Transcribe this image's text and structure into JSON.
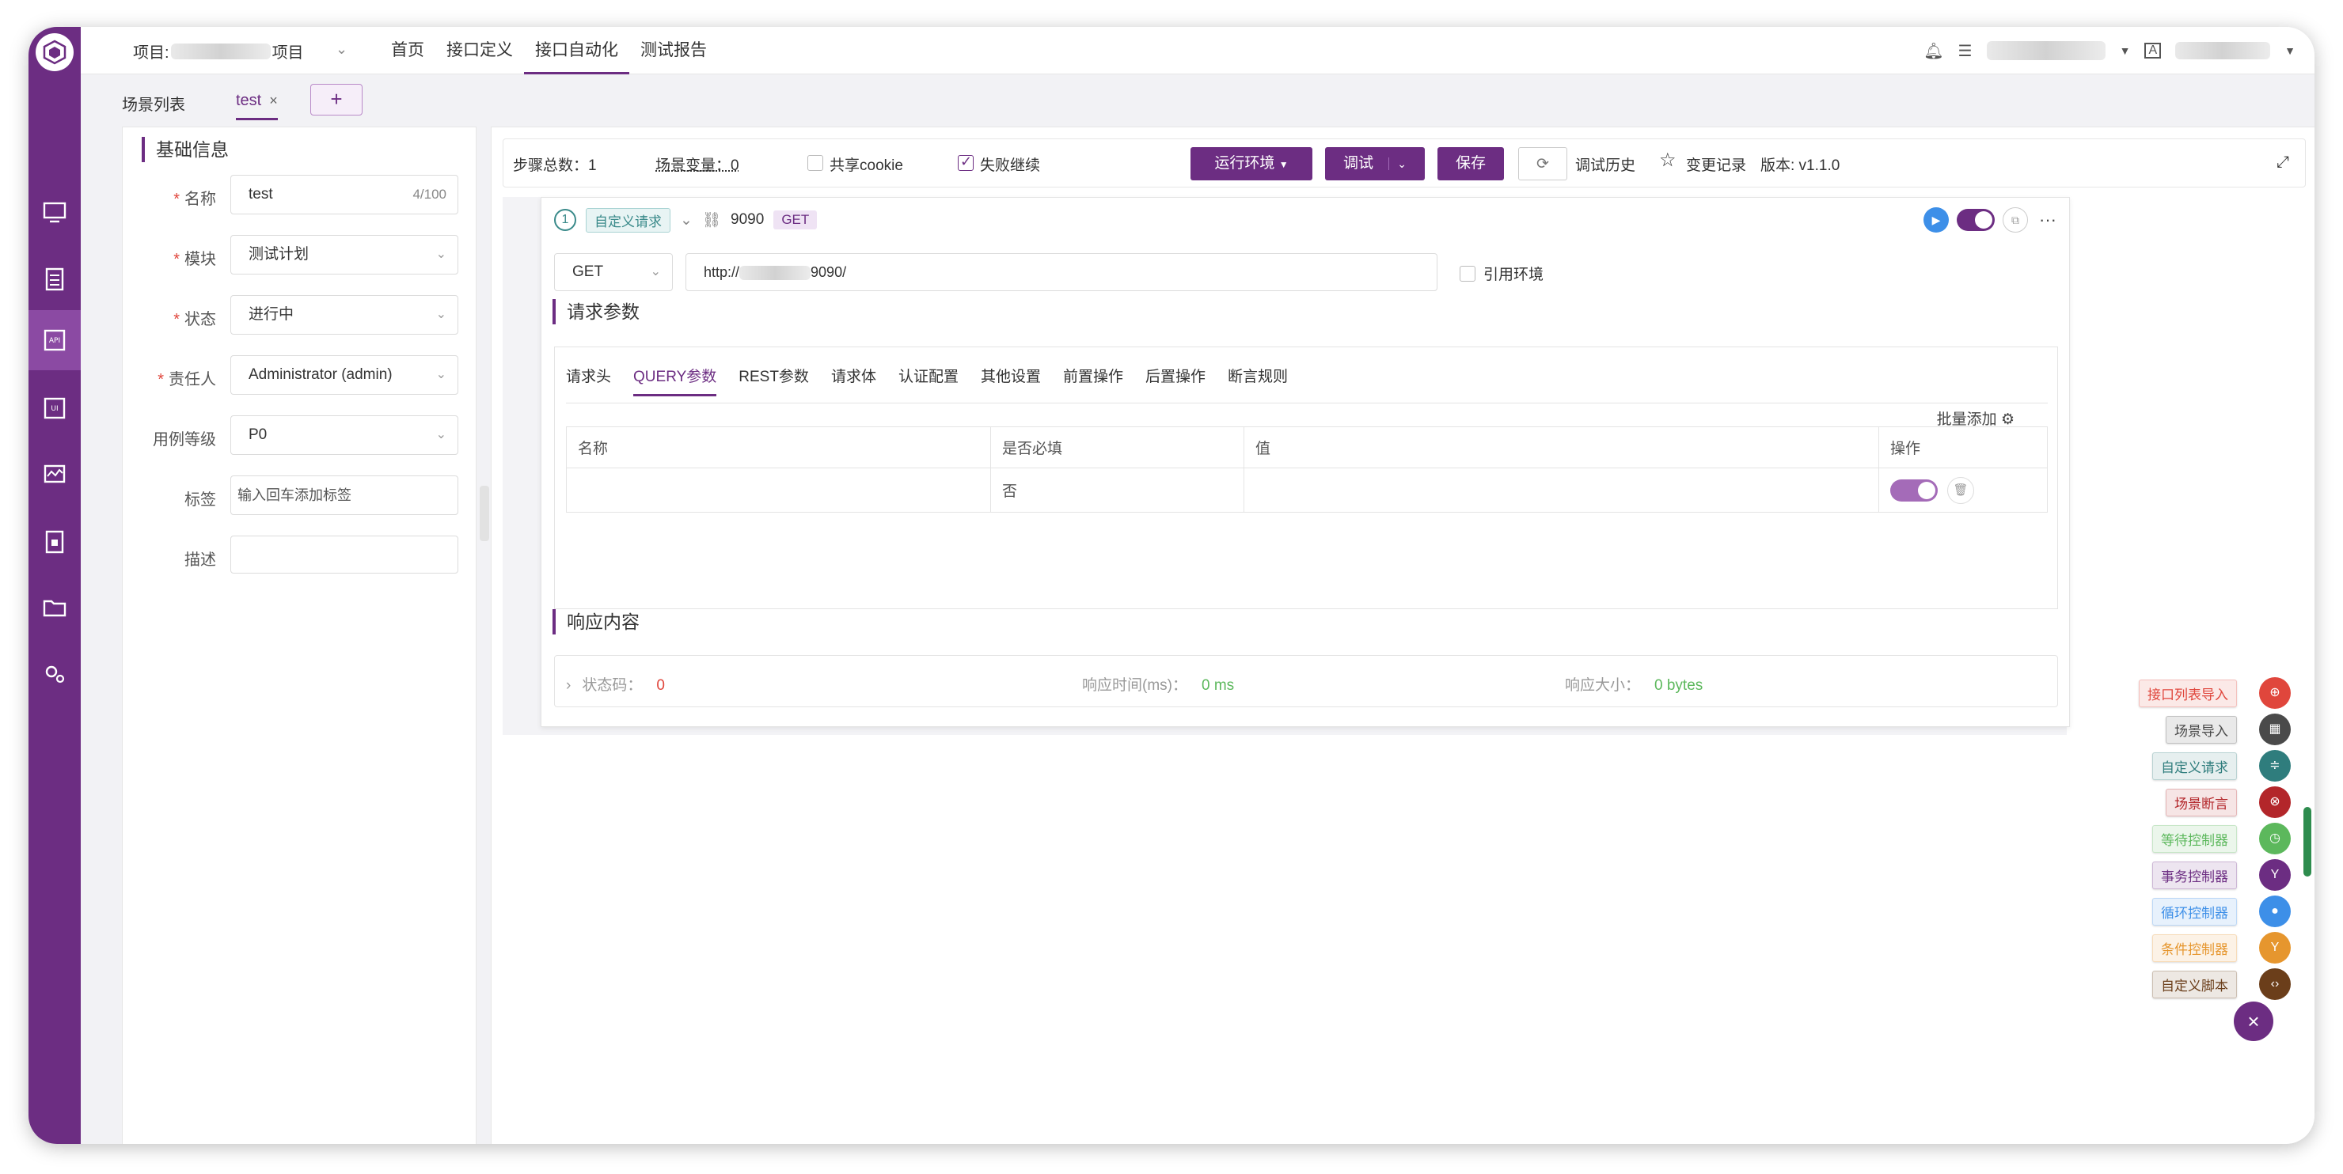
{
  "topbar": {
    "project_prefix": "项目:",
    "project_suffix": "项目",
    "nav": [
      "首页",
      "接口定义",
      "接口自动化",
      "测试报告"
    ],
    "active_nav": "接口自动化"
  },
  "tabs": {
    "list_label": "场景列表",
    "active_tab": "test",
    "close_glyph": "×",
    "add_glyph": "+"
  },
  "basic": {
    "title": "基础信息",
    "fields": {
      "name_label": "名称",
      "name_value": "test",
      "name_count": "4/100",
      "module_label": "模块",
      "module_value": "测试计划",
      "status_label": "状态",
      "status_value": "进行中",
      "owner_label": "责任人",
      "owner_value": "Administrator (admin)",
      "level_label": "用例等级",
      "level_value": "P0",
      "tags_label": "标签",
      "tags_placeholder": "输入回车添加标签",
      "desc_label": "描述"
    }
  },
  "toolbar": {
    "steps_total": "步骤总数：1",
    "scene_vars": "场景变量：0",
    "share_cookie": "共享cookie",
    "fail_continue": "失败继续",
    "run_env": "运行环境",
    "debug": "调试",
    "save": "保存",
    "debug_history": "调试历史",
    "change_record": "变更记录",
    "version": "版本: v1.1.0"
  },
  "step": {
    "index": "1",
    "type_tag": "自定义请求",
    "port": "9090",
    "method_tag": "GET",
    "method": "GET",
    "url_prefix": "http://",
    "url_suffix": "9090/",
    "ref_env": "引用环境",
    "params_title": "请求参数",
    "param_tabs": [
      "请求头",
      "QUERY参数",
      "REST参数",
      "请求体",
      "认证配置",
      "其他设置",
      "前置操作",
      "后置操作",
      "断言规则"
    ],
    "active_param_tab": "QUERY参数",
    "batch_add": "批量添加",
    "table_headers": [
      "名称",
      "是否必填",
      "值",
      "操作"
    ],
    "table_rows": [
      {
        "name": "",
        "required": "否",
        "value": ""
      }
    ],
    "response_title": "响应内容",
    "status_code_label": "状态码：",
    "status_code_value": "0",
    "resp_time_label": "响应时间(ms)：",
    "resp_time_value": "0 ms",
    "resp_size_label": "响应大小：",
    "resp_size_value": "0 bytes"
  },
  "fab_menu": [
    {
      "label": "接口列表导入",
      "color": "#e0463c"
    },
    {
      "label": "场景导入",
      "color": "#4a4a4a"
    },
    {
      "label": "自定义请求",
      "color": "#2f7d7d"
    },
    {
      "label": "场景断言",
      "color": "#b3262a"
    },
    {
      "label": "等待控制器",
      "color": "#5cb85c"
    },
    {
      "label": "事务控制器",
      "color": "#6c2d82"
    },
    {
      "label": "循环控制器",
      "color": "#3d8fe8"
    },
    {
      "label": "条件控制器",
      "color": "#e6962e"
    },
    {
      "label": "自定义脚本",
      "color": "#6b3e1a"
    }
  ],
  "fab_close": "×"
}
